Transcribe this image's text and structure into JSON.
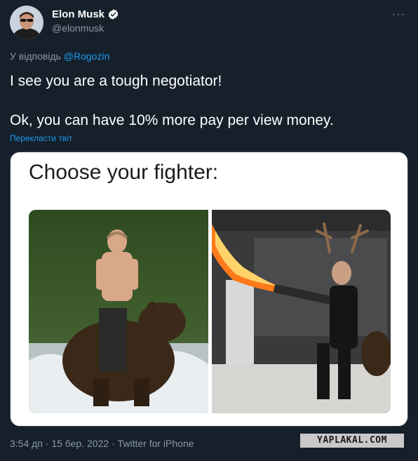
{
  "author": {
    "name": "Elon Musk",
    "handle": "@elonmusk",
    "verified_icon": "verified-badge-icon"
  },
  "more_icon": "···",
  "reply": {
    "prefix": "У відповідь",
    "mention": "@Rogozin"
  },
  "tweet": {
    "line1": "I see you are a tough negotiator!",
    "line2": "Ok, you can have 10% more pay per view money."
  },
  "translate_label": "Перекласти твіт",
  "media": {
    "meme_title": "Choose your fighter:"
  },
  "footer": {
    "time": "3:54 дп",
    "date": "15 бер. 2022",
    "client": "Twitter for iPhone",
    "full": "3:54 дп · 15 бер. 2022 · Twitter for iPhone"
  },
  "watermark": "YAPLAKAL.COM",
  "colors": {
    "background": "#15202b",
    "link": "#1d9bf0",
    "muted": "#8b98a5"
  }
}
